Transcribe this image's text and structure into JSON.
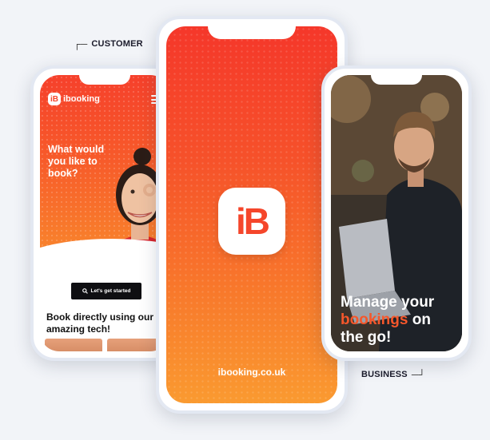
{
  "labels": {
    "customer": "CUSTOMER",
    "business": "BUSINESS"
  },
  "customer_screen": {
    "brand": "ibooking",
    "logo_mark": "iB",
    "headline": "What would you like to book?",
    "cta_label": "Let's get started",
    "cta_icon": "search-icon",
    "subheading": "Book directly using our amazing tech!",
    "menu_icon": "hamburger-menu-icon"
  },
  "splash_screen": {
    "app_icon_text": "iB",
    "domain": "ibooking.co.uk"
  },
  "business_screen": {
    "line1": "Manage your",
    "highlight": "bookings",
    "line2_rest": " on",
    "line3": "the go!"
  },
  "colors": {
    "brand_red": "#f5462b",
    "brand_orange": "#fa9a30",
    "background": "#f2f4f8",
    "cta_bg": "#0f0f12"
  }
}
